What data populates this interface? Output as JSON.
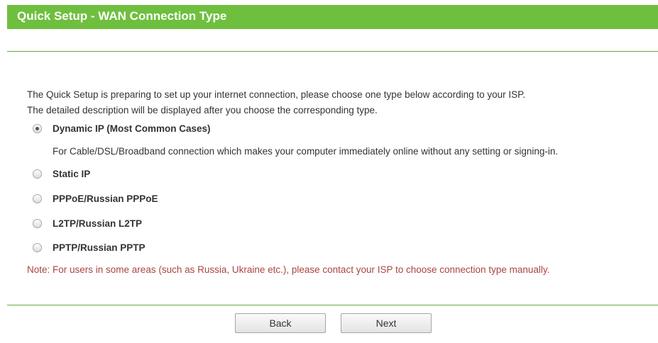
{
  "header": {
    "title": "Quick Setup - WAN Connection Type"
  },
  "intro": {
    "line1": "The Quick Setup is preparing to set up your internet connection, please choose one type below according to your ISP.",
    "line2": "The detailed description will be displayed after you choose the corresponding type."
  },
  "options": [
    {
      "label": "Dynamic IP (Most Common Cases)",
      "selected": true
    },
    {
      "label": "Static IP",
      "selected": false
    },
    {
      "label": "PPPoE/Russian PPPoE",
      "selected": false
    },
    {
      "label": "L2TP/Russian L2TP",
      "selected": false
    },
    {
      "label": "PPTP/Russian PPTP",
      "selected": false
    }
  ],
  "dynamic_description": "For Cable/DSL/Broadband connection which makes your computer immediately online without any setting or signing-in.",
  "note": "Note: For users in some areas (such as Russia, Ukraine etc.), please contact your ISP to choose connection type manually.",
  "buttons": {
    "back": "Back",
    "next": "Next"
  },
  "colors": {
    "header_bg": "#6fbf3f",
    "header_text": "#ffffff",
    "divider": "#63ab3c",
    "note_text": "#a94442"
  },
  "icons": {
    "selected_radio": "radio-checked-icon",
    "unselected_radio": "radio-unchecked-icon"
  }
}
